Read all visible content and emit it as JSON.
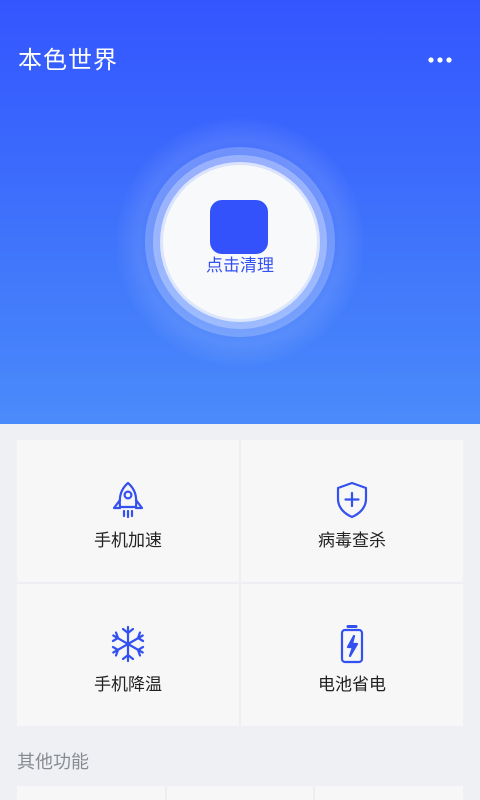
{
  "header": {
    "title": "本色世界",
    "menu_icon": "more-dots-icon"
  },
  "hero": {
    "clean_label": "点击清理",
    "accent": "#3352fb",
    "gradient": [
      "#3355ff",
      "#4a8bfb"
    ]
  },
  "tools": [
    {
      "label": "手机加速",
      "icon": "rocket-icon"
    },
    {
      "label": "病毒查杀",
      "icon": "shield-plus-icon"
    },
    {
      "label": "手机降温",
      "icon": "snowflake-icon"
    },
    {
      "label": "电池省电",
      "icon": "battery-bolt-icon"
    }
  ],
  "other": {
    "title": "其他功能"
  }
}
